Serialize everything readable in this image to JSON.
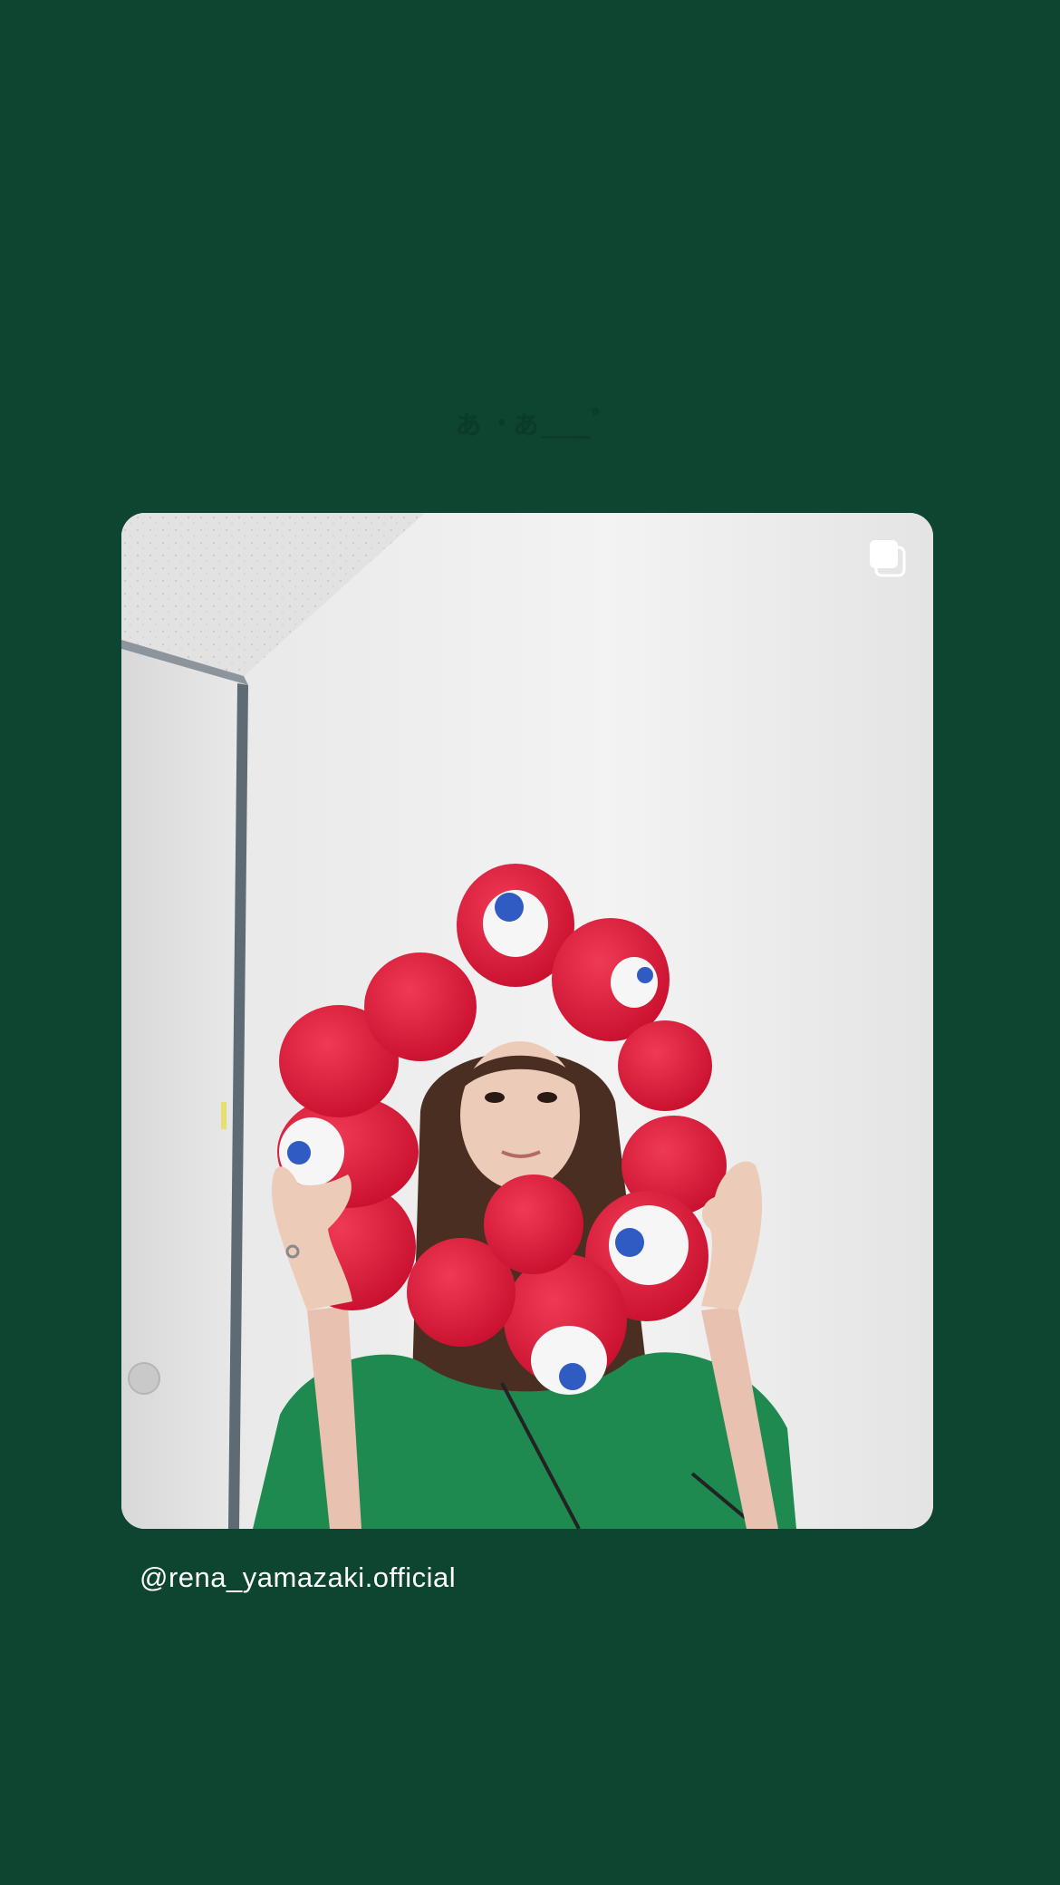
{
  "story": {
    "background_color": "#0d4530",
    "post": {
      "photo_alt": "Person in a green shirt holding a red plush donut ring with cartoon eyes in front of a white wall",
      "multiple_photos_icon": "multiple-photos-icon"
    },
    "username": "@rena_yamazaki.official"
  }
}
